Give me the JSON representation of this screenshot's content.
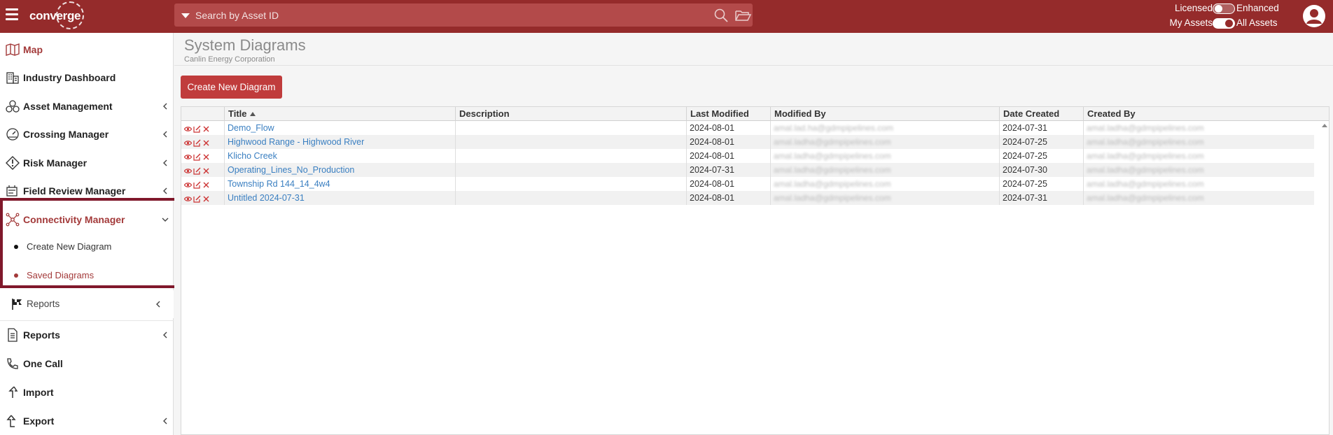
{
  "topbar": {
    "logo_text": "converge",
    "search_placeholder": "Search by Asset ID",
    "toggle1_left": "Licensed",
    "toggle1_right": "Enhanced",
    "toggle2_left": "My Assets",
    "toggle2_right": "All Assets"
  },
  "sidebar": {
    "items": [
      {
        "label": "Map"
      },
      {
        "label": "Industry Dashboard"
      },
      {
        "label": "Asset Management"
      },
      {
        "label": "Crossing Manager"
      },
      {
        "label": "Risk Manager"
      },
      {
        "label": "Field Review Manager"
      },
      {
        "label": "Connectivity Manager"
      },
      {
        "label": "Reports"
      },
      {
        "label": "Reports"
      },
      {
        "label": "One Call"
      },
      {
        "label": "Import"
      },
      {
        "label": "Export"
      }
    ],
    "sub_items": [
      {
        "label": "Create New Diagram"
      },
      {
        "label": "Saved Diagrams"
      }
    ]
  },
  "main": {
    "title": "System Diagrams",
    "subtitle": "Canlin Energy Corporation",
    "create_button": "Create New Diagram"
  },
  "table": {
    "columns": [
      "Title",
      "Description",
      "Last Modified",
      "Modified By",
      "Date Created",
      "Created By"
    ],
    "rows": [
      {
        "title": "Demo_Flow",
        "description": "",
        "last_modified": "2024-08-01",
        "modified_by": "amal.lad.ha@gdmpipelines.com",
        "date_created": "2024-07-31",
        "created_by": "amal.ladha@gdmpipelines.com"
      },
      {
        "title": "Highwood Range - Highwood River",
        "description": "",
        "last_modified": "2024-08-01",
        "modified_by": "amal.ladha@gdmpipelines.com",
        "date_created": "2024-07-25",
        "created_by": "amal.ladha@gdmpipelines.com"
      },
      {
        "title": "Klicho Creek",
        "description": "",
        "last_modified": "2024-08-01",
        "modified_by": "amal.ladha@gdmpipelines.com",
        "date_created": "2024-07-25",
        "created_by": "amal.ladha@gdmpipelines.com"
      },
      {
        "title": "Operating_Lines_No_Production",
        "description": "",
        "last_modified": "2024-07-31",
        "modified_by": "amal.ladha@gdmpipelines.com",
        "date_created": "2024-07-30",
        "created_by": "amal.ladha@gdmpipelines.com"
      },
      {
        "title": "Township Rd 144_14_4w4",
        "description": "",
        "last_modified": "2024-08-01",
        "modified_by": "amal.ladha@gdmpipelines.com",
        "date_created": "2024-07-25",
        "created_by": "amal.ladha@gdmpipelines.com"
      },
      {
        "title": "Untitled 2024-07-31",
        "description": "",
        "last_modified": "2024-08-01",
        "modified_by": "amal.ladha@gdmpipelines.com",
        "date_created": "2024-07-31",
        "created_by": "amal.ladha@gdmpipelines.com"
      }
    ]
  },
  "colors": {
    "brand": "#952b2b",
    "button": "#c03c3c",
    "link": "#3a7fc1",
    "highlight_border": "#80182b",
    "active_nav": "#a33a3a"
  },
  "icons": {
    "hamburger": "menu-icon",
    "search": "search-icon",
    "folder": "folder-open-icon",
    "avatar": "user-avatar-icon",
    "row_actions": [
      "eye-icon",
      "edit-icon",
      "close-icon"
    ]
  }
}
